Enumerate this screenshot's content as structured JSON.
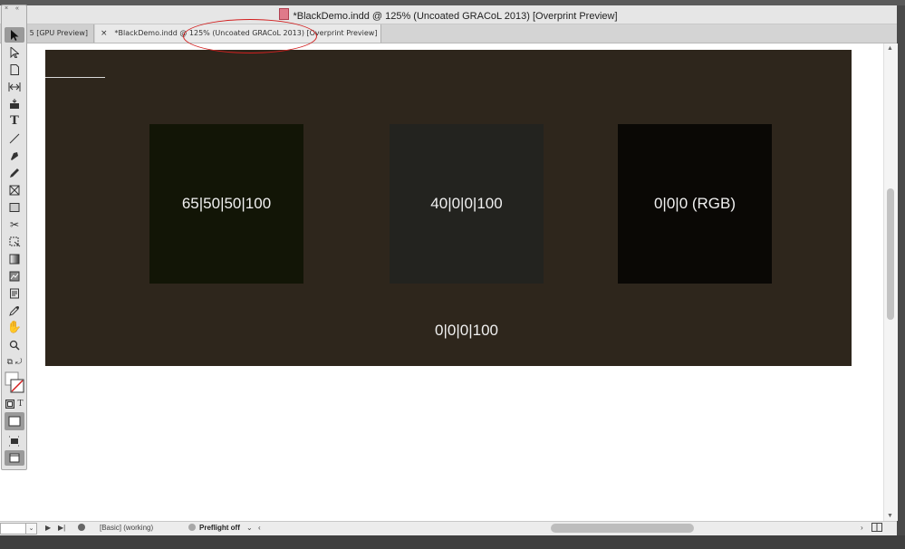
{
  "window": {
    "title": "*BlackDemo.indd @ 125% (Uncoated GRACoL 2013) [Overprint Preview]"
  },
  "tabs": [
    {
      "label": "5 [GPU Preview]",
      "active": false
    },
    {
      "label": "*BlackDemo.indd @ 125% (Uncoated GRACoL 2013) [Overprint Preview]",
      "active": true,
      "close": "×"
    }
  ],
  "toolbox": {
    "header": "×  «",
    "tools": [
      "selection-tool",
      "direct-selection-tool",
      "page-tool",
      "gap-tool",
      "content-collector-tool",
      "type-tool",
      "line-tool",
      "pen-tool",
      "pencil-tool",
      "rectangle-frame-tool",
      "rectangle-tool",
      "scissors-tool",
      "free-transform-tool",
      "gradient-swatch-tool",
      "gradient-feather-tool",
      "note-tool",
      "eyedropper-tool",
      "hand-tool",
      "zoom-tool"
    ],
    "format_text_label": "T"
  },
  "swatches": [
    {
      "label": "65|50|50|100",
      "color": "#121506"
    },
    {
      "label": "40|0|0|100",
      "color": "#23231f"
    },
    {
      "label": "0|0|0 (RGB)",
      "color": "#0a0805"
    }
  ],
  "spread": {
    "color": "#2e261c",
    "label": "0|0|0|100"
  },
  "status": {
    "page_value": "",
    "profile": "[Basic] (working)",
    "preflight": "Preflight off"
  },
  "accent": {
    "callout": "#d21f1f"
  }
}
